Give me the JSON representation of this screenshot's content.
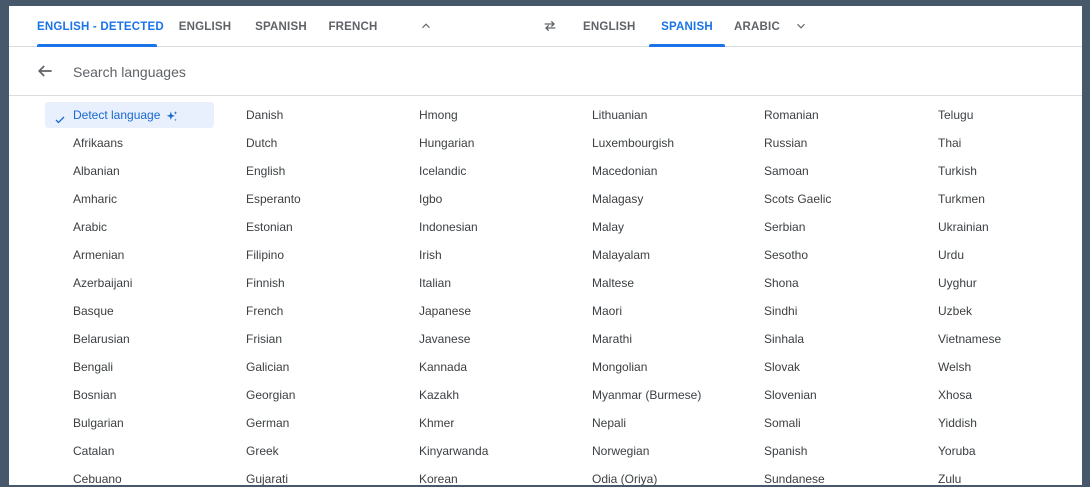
{
  "source_tabs": [
    "ENGLISH - DETECTED",
    "ENGLISH",
    "SPANISH",
    "FRENCH"
  ],
  "target_tabs": [
    "ENGLISH",
    "SPANISH",
    "ARABIC"
  ],
  "search": {
    "placeholder": "Search languages",
    "value": ""
  },
  "detect_language_label": "Detect language",
  "columns": [
    [
      "Afrikaans",
      "Albanian",
      "Amharic",
      "Arabic",
      "Armenian",
      "Azerbaijani",
      "Basque",
      "Belarusian",
      "Bengali",
      "Bosnian",
      "Bulgarian",
      "Catalan",
      "Cebuano"
    ],
    [
      "Danish",
      "Dutch",
      "English",
      "Esperanto",
      "Estonian",
      "Filipino",
      "Finnish",
      "French",
      "Frisian",
      "Galician",
      "Georgian",
      "German",
      "Greek",
      "Gujarati"
    ],
    [
      "Hmong",
      "Hungarian",
      "Icelandic",
      "Igbo",
      "Indonesian",
      "Irish",
      "Italian",
      "Japanese",
      "Javanese",
      "Kannada",
      "Kazakh",
      "Khmer",
      "Kinyarwanda",
      "Korean"
    ],
    [
      "Lithuanian",
      "Luxembourgish",
      "Macedonian",
      "Malagasy",
      "Malay",
      "Malayalam",
      "Maltese",
      "Maori",
      "Marathi",
      "Mongolian",
      "Myanmar (Burmese)",
      "Nepali",
      "Norwegian",
      "Odia (Oriya)"
    ],
    [
      "Romanian",
      "Russian",
      "Samoan",
      "Scots Gaelic",
      "Serbian",
      "Sesotho",
      "Shona",
      "Sindhi",
      "Sinhala",
      "Slovak",
      "Slovenian",
      "Somali",
      "Spanish",
      "Sundanese"
    ],
    [
      "Telugu",
      "Thai",
      "Turkish",
      "Turkmen",
      "Ukrainian",
      "Urdu",
      "Uyghur",
      "Uzbek",
      "Vietnamese",
      "Welsh",
      "Xhosa",
      "Yiddish",
      "Yoruba",
      "Zulu"
    ]
  ],
  "colors": {
    "accent": "#1a73e8",
    "selected_bg": "#e8f0fe",
    "text": "#3c4043",
    "muted": "#5f6368",
    "frame": "#47586b"
  },
  "icons": [
    "chevron-up-icon",
    "swap-icon",
    "chevron-down-icon",
    "arrow-back-icon",
    "check-icon",
    "sparkle-icon"
  ]
}
